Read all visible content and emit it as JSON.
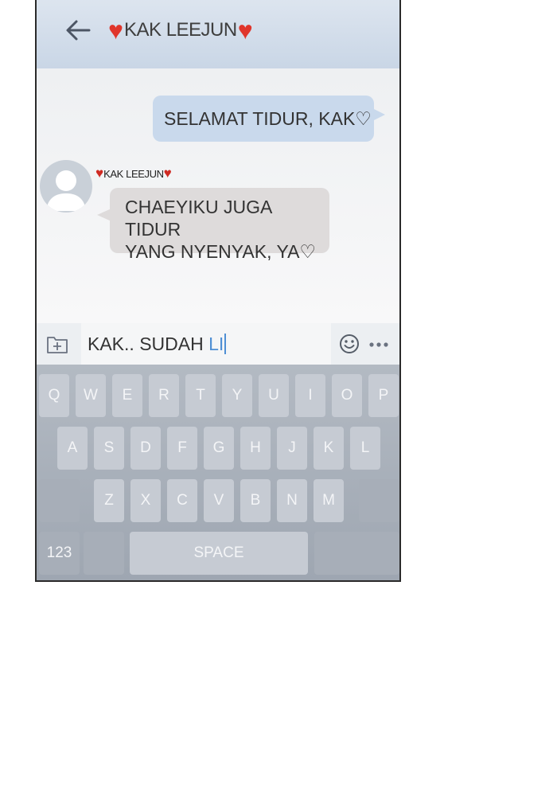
{
  "header": {
    "title": "KAK LEEJUN",
    "heart": "♥"
  },
  "messages": {
    "outgoing": "SELAMAT TIDUR, KAK♡",
    "incoming_sender": "KAK LEEJUN",
    "incoming_line1": "CHAEYIKU JUGA TIDUR",
    "incoming_line2": "YANG NYENYAK, YA♡"
  },
  "input": {
    "text_prefix": "KAK.. SUDAH ",
    "text_highlight": "LI"
  },
  "keyboard": {
    "row1": [
      "Q",
      "W",
      "E",
      "R",
      "T",
      "Y",
      "U",
      "I",
      "O",
      "P"
    ],
    "row2": [
      "A",
      "S",
      "D",
      "F",
      "G",
      "H",
      "J",
      "K",
      "L"
    ],
    "row3": [
      "Z",
      "X",
      "C",
      "V",
      "B",
      "N",
      "M"
    ],
    "numbers_key": "123",
    "space_key": "SPACE"
  },
  "colors": {
    "heart": "#e0352b",
    "outgoing_bubble": "#c9d9ec",
    "incoming_bubble": "#dedbdb",
    "caret": "#4f8fd4"
  },
  "icons": [
    "back-arrow-icon",
    "heart-icon",
    "avatar-icon",
    "attach-file-icon",
    "emoji-icon",
    "more-options-icon"
  ]
}
